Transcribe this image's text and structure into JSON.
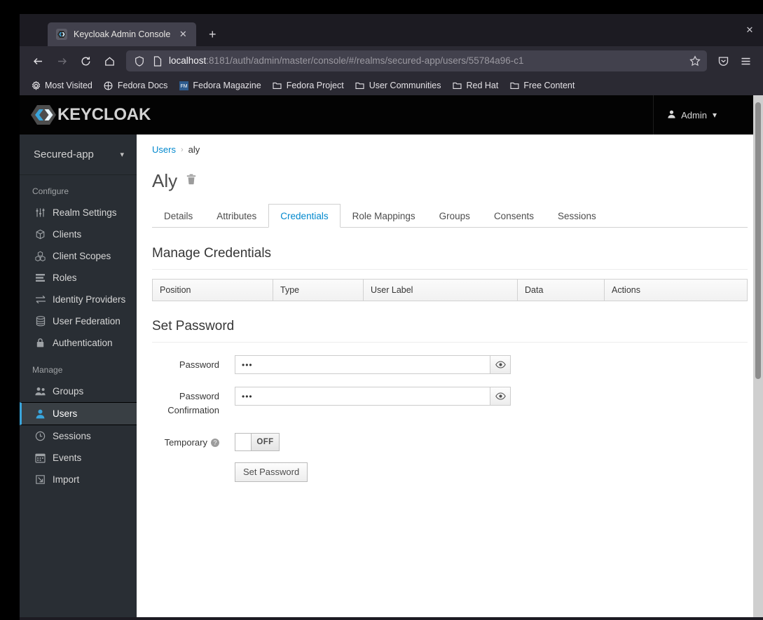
{
  "browser": {
    "tab": {
      "title": "Keycloak Admin Console",
      "favicon": "keycloak-favicon",
      "close_label": "✕"
    },
    "new_tab_label": "+",
    "window_close_label": "✕",
    "nav": {
      "back": "back-arrow",
      "forward": "forward-arrow",
      "reload": "reload-arrow",
      "home": "home-house"
    },
    "url": {
      "host": "localhost",
      "path": ":8181/auth/admin/master/console/#/realms/secured-app/users/55784a96-c1",
      "full": "localhost:8181/auth/admin/master/console/#/realms/secured-app/users/55784a96-c1"
    },
    "bookmarks": [
      {
        "label": "Most Visited",
        "icon": "gear-icon"
      },
      {
        "label": "Fedora Docs",
        "icon": "globe-icon"
      },
      {
        "label": "Fedora Magazine",
        "icon": "magazine-icon"
      },
      {
        "label": "Fedora Project",
        "icon": "folder-icon"
      },
      {
        "label": "User Communities",
        "icon": "folder-icon"
      },
      {
        "label": "Red Hat",
        "icon": "folder-icon"
      },
      {
        "label": "Free Content",
        "icon": "folder-icon"
      }
    ]
  },
  "app": {
    "brand": "KEYCLOAK",
    "user_menu": {
      "label": "Admin",
      "icon": "user-icon",
      "caret": "⌄"
    },
    "realm_selector": {
      "name": "Secured-app",
      "caret": "⌄"
    },
    "sidebar": {
      "sections": [
        {
          "title": "Configure",
          "items": [
            {
              "label": "Realm Settings",
              "icon": "sliders-icon",
              "active": false
            },
            {
              "label": "Clients",
              "icon": "cube-icon",
              "active": false
            },
            {
              "label": "Client Scopes",
              "icon": "cubes-icon",
              "active": false
            },
            {
              "label": "Roles",
              "icon": "list-icon",
              "active": false
            },
            {
              "label": "Identity Providers",
              "icon": "exchange-icon",
              "active": false
            },
            {
              "label": "User Federation",
              "icon": "database-icon",
              "active": false
            },
            {
              "label": "Authentication",
              "icon": "lock-icon",
              "active": false
            }
          ]
        },
        {
          "title": "Manage",
          "items": [
            {
              "label": "Groups",
              "icon": "users-icon",
              "active": false
            },
            {
              "label": "Users",
              "icon": "user-icon",
              "active": true
            },
            {
              "label": "Sessions",
              "icon": "clock-icon",
              "active": false
            },
            {
              "label": "Events",
              "icon": "calendar-icon",
              "active": false
            },
            {
              "label": "Import",
              "icon": "import-icon",
              "active": false
            }
          ]
        }
      ]
    },
    "breadcrumb": {
      "parent": "Users",
      "separator": "›",
      "current": "aly"
    },
    "page_title": "Aly",
    "delete_icon": "trash-icon",
    "tabs": [
      {
        "label": "Details",
        "active": false
      },
      {
        "label": "Attributes",
        "active": false
      },
      {
        "label": "Credentials",
        "active": true
      },
      {
        "label": "Role Mappings",
        "active": false
      },
      {
        "label": "Groups",
        "active": false
      },
      {
        "label": "Consents",
        "active": false
      },
      {
        "label": "Sessions",
        "active": false
      }
    ],
    "manage_credentials": {
      "title": "Manage Credentials",
      "columns": [
        "Position",
        "Type",
        "User Label",
        "Data",
        "Actions"
      ],
      "rows": []
    },
    "set_password": {
      "title": "Set Password",
      "password": {
        "label": "Password",
        "value": "•••",
        "toggle_icon": "eye-icon"
      },
      "password_confirmation": {
        "label": "Password Confirmation",
        "value": "•••",
        "toggle_icon": "eye-icon"
      },
      "temporary": {
        "label": "Temporary",
        "help_icon": "question-icon",
        "state": "OFF"
      },
      "submit_label": "Set Password"
    }
  },
  "colors": {
    "accent": "#0088ce",
    "sidebar_bg": "#292e34",
    "active_nav": "#39a5dc",
    "header_bg": "#030303",
    "browser_chrome": "#2b2a33"
  }
}
